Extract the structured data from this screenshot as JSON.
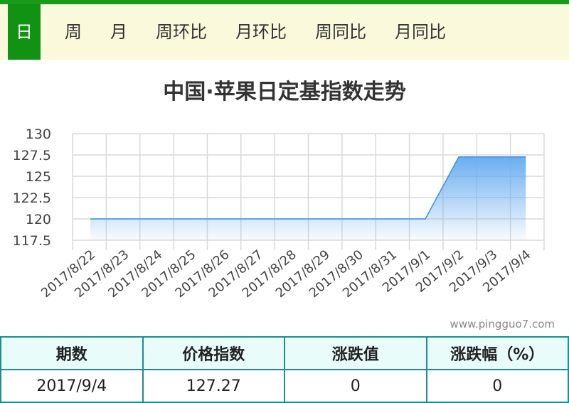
{
  "tabs": [
    "日",
    "周",
    "月",
    "周环比",
    "月环比",
    "周同比",
    "月同比"
  ],
  "active_tab": 0,
  "chart_data": {
    "type": "area",
    "title": "中国·苹果日定基指数走势",
    "categories": [
      "2017/8/22",
      "2017/8/23",
      "2017/8/24",
      "2017/8/25",
      "2017/8/26",
      "2017/8/27",
      "2017/8/28",
      "2017/8/29",
      "2017/8/30",
      "2017/8/31",
      "2017/9/1",
      "2017/9/2",
      "2017/9/3",
      "2017/9/4"
    ],
    "values": [
      120.0,
      120.0,
      120.0,
      120.0,
      120.0,
      120.0,
      120.0,
      120.0,
      120.0,
      120.0,
      120.0,
      127.27,
      127.27,
      127.27
    ],
    "ylim": [
      117.5,
      130
    ],
    "yticks": [
      "130",
      "127.5",
      "125",
      "122.5",
      "120",
      "117.5"
    ],
    "grid": true,
    "colors": {
      "fill": "#6aaef0",
      "line": "#3b8fe0",
      "grid": "#d9d9d9"
    }
  },
  "watermark": "www.pingguo7.com",
  "table": {
    "headers": [
      "期数",
      "价格指数",
      "涨跌值",
      "涨跌幅（%）"
    ],
    "row": [
      "2017/9/4",
      "127.27",
      "0",
      "0"
    ]
  }
}
